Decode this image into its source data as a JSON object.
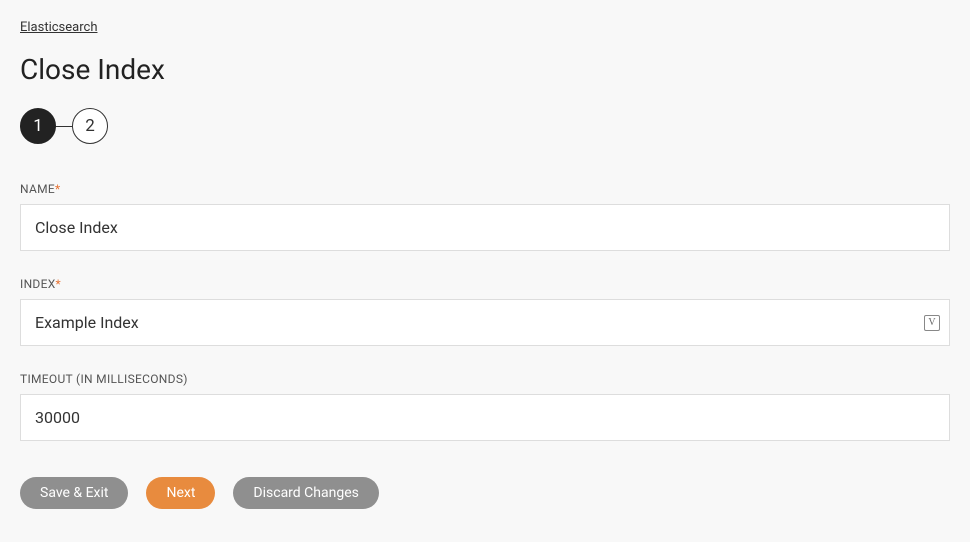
{
  "breadcrumb": {
    "parent": "Elasticsearch"
  },
  "page": {
    "title": "Close Index"
  },
  "stepper": {
    "steps": [
      "1",
      "2"
    ],
    "active_index": 0
  },
  "fields": {
    "name": {
      "label": "NAME",
      "required": true,
      "value": "Close Index"
    },
    "index": {
      "label": "INDEX",
      "required": true,
      "value": "Example Index",
      "variable_icon": "V"
    },
    "timeout": {
      "label": "TIMEOUT (IN MILLISECONDS)",
      "required": false,
      "value": "30000"
    }
  },
  "buttons": {
    "save_exit": "Save & Exit",
    "next": "Next",
    "discard": "Discard Changes"
  },
  "required_marker": "*"
}
